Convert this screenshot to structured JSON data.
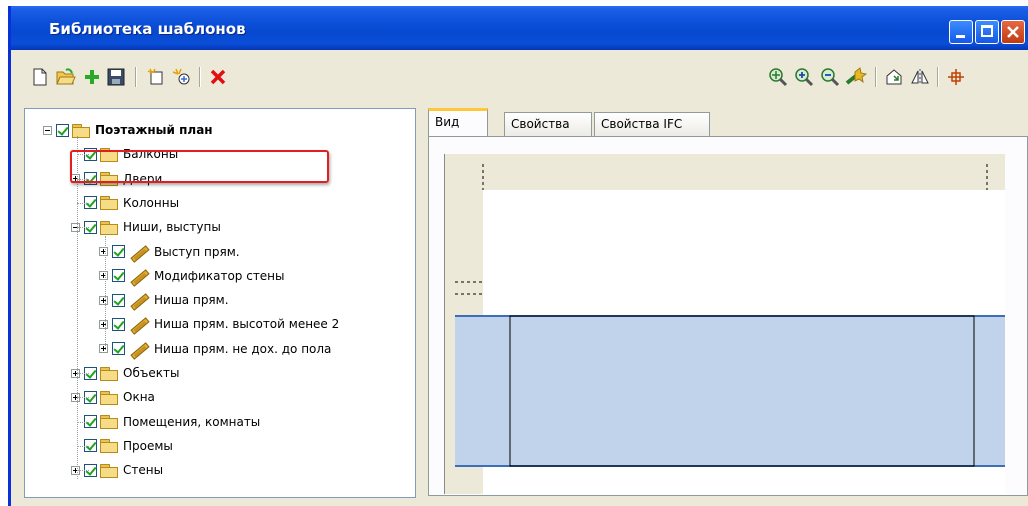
{
  "window": {
    "title": "Библиотека шаблонов"
  },
  "toolbar_left": [
    {
      "icon": "new-document-icon",
      "glyph": "🗋"
    },
    {
      "icon": "open-folder-icon",
      "glyph": "📂"
    },
    {
      "icon": "add-icon",
      "glyph": "✚",
      "color": "#2aa82a"
    },
    {
      "icon": "save-icon",
      "glyph": "💾"
    },
    {
      "icon": "new-template-icon",
      "glyph": "✳"
    },
    {
      "icon": "sparkle-template-icon",
      "glyph": "✴"
    },
    {
      "icon": "delete-icon",
      "glyph": "✕",
      "color": "#e01010"
    }
  ],
  "toolbar_right": [
    {
      "icon": "zoom-all-icon",
      "glyph": "⊕"
    },
    {
      "icon": "zoom-in-icon",
      "glyph": "⊕"
    },
    {
      "icon": "zoom-out-icon",
      "glyph": "⊖"
    },
    {
      "icon": "pan-icon",
      "glyph": "✥"
    },
    {
      "icon": "3d-view-icon",
      "glyph": "⌂"
    },
    {
      "icon": "mirror-icon",
      "glyph": "◭"
    },
    {
      "icon": "base-point-icon",
      "glyph": "⌖"
    }
  ],
  "tree": [
    {
      "label": "Поэтажный план",
      "level": 0,
      "bold": true,
      "expander": "minus",
      "icon": "folder"
    },
    {
      "label": "Балконы",
      "level": 1,
      "expander": "none",
      "icon": "folder"
    },
    {
      "label": "Двери",
      "level": 1,
      "expander": "plus",
      "icon": "folder"
    },
    {
      "label": "Колонны",
      "level": 1,
      "expander": "none",
      "icon": "folder"
    },
    {
      "label": "Ниши, выступы",
      "level": 1,
      "expander": "minus",
      "icon": "folder"
    },
    {
      "label": "Выступ прям.",
      "level": 2,
      "expander": "plus",
      "icon": "pencil"
    },
    {
      "label": "Модификатор стены",
      "level": 2,
      "expander": "plus",
      "icon": "pencil"
    },
    {
      "label": "Ниша прям.",
      "level": 2,
      "expander": "plus",
      "icon": "pencil"
    },
    {
      "label": "Ниша прям. высотой менее 2",
      "level": 2,
      "expander": "plus",
      "icon": "pencil"
    },
    {
      "label": "Ниша прям. не дох. до пола",
      "level": 2,
      "expander": "plus",
      "icon": "pencil"
    },
    {
      "label": "Объекты",
      "level": 1,
      "expander": "plus",
      "icon": "folder"
    },
    {
      "label": "Окна",
      "level": 1,
      "expander": "plus",
      "icon": "folder"
    },
    {
      "label": "Помещения, комнаты",
      "level": 1,
      "expander": "none",
      "icon": "folder"
    },
    {
      "label": "Проемы",
      "level": 1,
      "expander": "none",
      "icon": "folder"
    },
    {
      "label": "Стены",
      "level": 1,
      "expander": "plus",
      "icon": "folder"
    }
  ],
  "tabs": [
    {
      "label": "Вид",
      "active": true
    },
    {
      "label": "Свойства",
      "active": false
    },
    {
      "label": "Свойства IFC",
      "active": false
    }
  ],
  "colors": {
    "titlebar": "#0a4fd8",
    "window_bg": "#ece9d8",
    "highlight_frame": "#e02020",
    "wall_fill": "#c0d3ea",
    "wall_line": "#3d6fb8"
  }
}
